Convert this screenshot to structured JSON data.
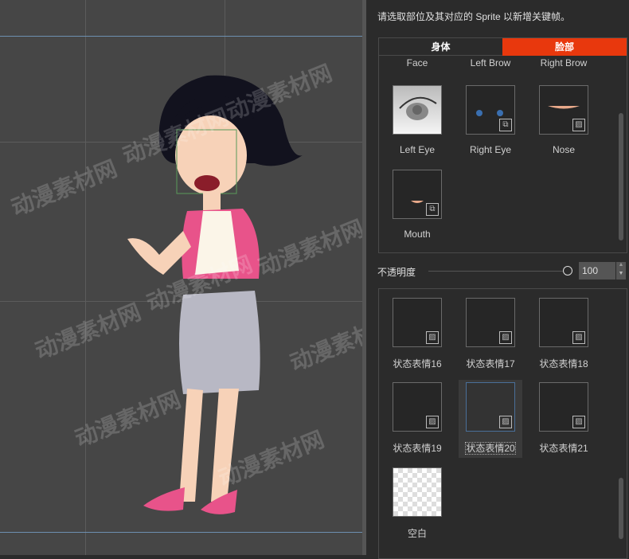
{
  "panel": {
    "instruction": "请选取部位及其对应的 Sprite 以新增关键帧。",
    "tabs": [
      {
        "label": "身体",
        "active": false
      },
      {
        "label": "脸部",
        "active": true
      }
    ],
    "accent_color": "#e8380d",
    "parts": [
      {
        "label": "Face"
      },
      {
        "label": "Left Brow"
      },
      {
        "label": "Right Brow"
      },
      {
        "label": "Left Eye",
        "icon": "eye-preview"
      },
      {
        "label": "Right Eye",
        "icon": "puzzle-icon"
      },
      {
        "label": "Nose",
        "icon": "image-icon"
      },
      {
        "label": "Mouth",
        "icon": "puzzle-icon"
      }
    ],
    "opacity": {
      "label": "不透明度",
      "value": "100",
      "slider_percent": 100
    },
    "sprites": [
      {
        "label": "状态表情16"
      },
      {
        "label": "状态表情17"
      },
      {
        "label": "状态表情18"
      },
      {
        "label": "状态表情19"
      },
      {
        "label": "状态表情20",
        "selected": true
      },
      {
        "label": "状态表情21"
      },
      {
        "label": "空白"
      }
    ]
  },
  "watermark": "动漫素材网"
}
